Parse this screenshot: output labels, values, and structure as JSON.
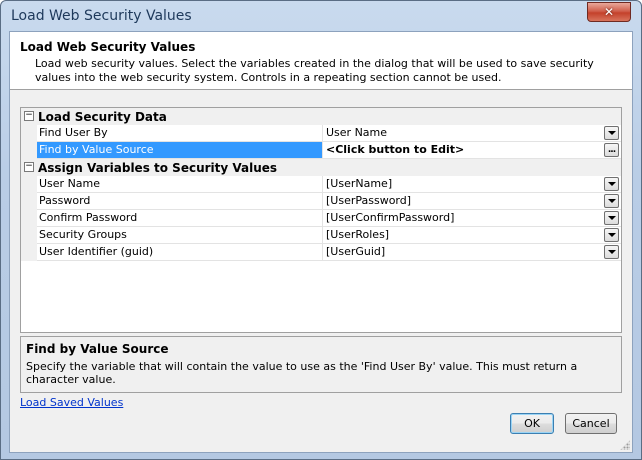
{
  "window": {
    "title": "Load Web Security Values",
    "close_glyph": "✕"
  },
  "header": {
    "title": "Load Web Security Values",
    "description": "Load web security values. Select the variables created in the dialog that will be used to save security values into the web security system.  Controls in a repeating section cannot be used."
  },
  "grid": {
    "categories": [
      {
        "label": "Load Security Data",
        "toggle": "−",
        "properties": [
          {
            "name": "Find User By",
            "value": "User Name",
            "button": "dropdown"
          },
          {
            "name": "Find by Value Source",
            "value": "<Click button to Edit>",
            "button": "ellipsis",
            "selected": true
          }
        ]
      },
      {
        "label": "Assign Variables to Security Values",
        "toggle": "−",
        "properties": [
          {
            "name": "User Name",
            "value": "[UserName]",
            "button": "dropdown"
          },
          {
            "name": "Password",
            "value": "[UserPassword]",
            "button": "dropdown"
          },
          {
            "name": "Confirm Password",
            "value": "[UserConfirmPassword]",
            "button": "dropdown"
          },
          {
            "name": "Security Groups",
            "value": "[UserRoles]",
            "button": "dropdown"
          },
          {
            "name": "User Identifier (guid)",
            "value": "[UserGuid]",
            "button": "dropdown"
          }
        ]
      }
    ],
    "ellipsis_label": "..."
  },
  "help": {
    "title": "Find by Value Source",
    "description": "Specify the variable that will contain the value to use as the 'Find User By' value.  This must return a character value."
  },
  "footer": {
    "link_label": "Load Saved Values",
    "ok_label": "OK",
    "cancel_label": "Cancel"
  }
}
